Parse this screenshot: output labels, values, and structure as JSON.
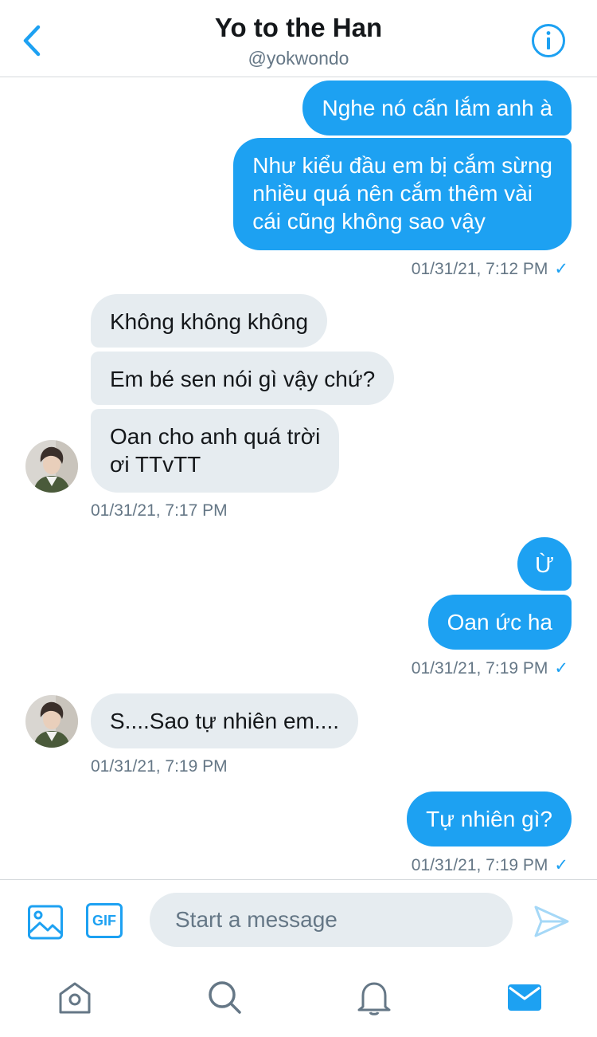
{
  "header": {
    "title": "Yo to the Han",
    "handle": "@yokwondo"
  },
  "messages": [
    {
      "dir": "out",
      "lines": [
        "Nghe nó cấn lắm anh à"
      ]
    },
    {
      "dir": "out",
      "lines": [
        "Như kiểu đầu em bị cắm sừng",
        "nhiều quá nên cắm thêm vài",
        "cái cũng không sao vậy"
      ]
    },
    {
      "dir": "stamp-out",
      "text": "01/31/21, 7:12 PM"
    },
    {
      "dir": "in",
      "lines": [
        "Không không không"
      ]
    },
    {
      "dir": "in",
      "lines": [
        "Em bé sen nói gì vậy chứ?"
      ]
    },
    {
      "dir": "in",
      "lines": [
        "Oan cho anh quá trời",
        "ơi  TTvTT"
      ]
    },
    {
      "dir": "stamp-in",
      "text": "01/31/21, 7:17 PM"
    },
    {
      "dir": "out",
      "lines": [
        "Ừ"
      ]
    },
    {
      "dir": "out",
      "lines": [
        "Oan ức ha"
      ]
    },
    {
      "dir": "stamp-out",
      "text": "01/31/21, 7:19 PM"
    },
    {
      "dir": "in",
      "lines": [
        "S....Sao tự nhiên em...."
      ]
    },
    {
      "dir": "stamp-in",
      "text": "01/31/21, 7:19 PM"
    },
    {
      "dir": "out",
      "lines": [
        "Tự nhiên gì?"
      ]
    },
    {
      "dir": "stamp-out",
      "text": "01/31/21, 7:19 PM"
    }
  ],
  "composer": {
    "gif_label": "GIF",
    "placeholder": "Start a message"
  },
  "icons": {
    "back": "chevron-left-icon",
    "info": "info-icon",
    "media": "image-icon",
    "send": "send-icon",
    "tabs": [
      "home-icon",
      "search-icon",
      "bell-icon",
      "mail-icon"
    ]
  },
  "colors": {
    "accent": "#1da1f2",
    "incoming_bubble": "#e6ecf0",
    "secondary_text": "#657786"
  }
}
